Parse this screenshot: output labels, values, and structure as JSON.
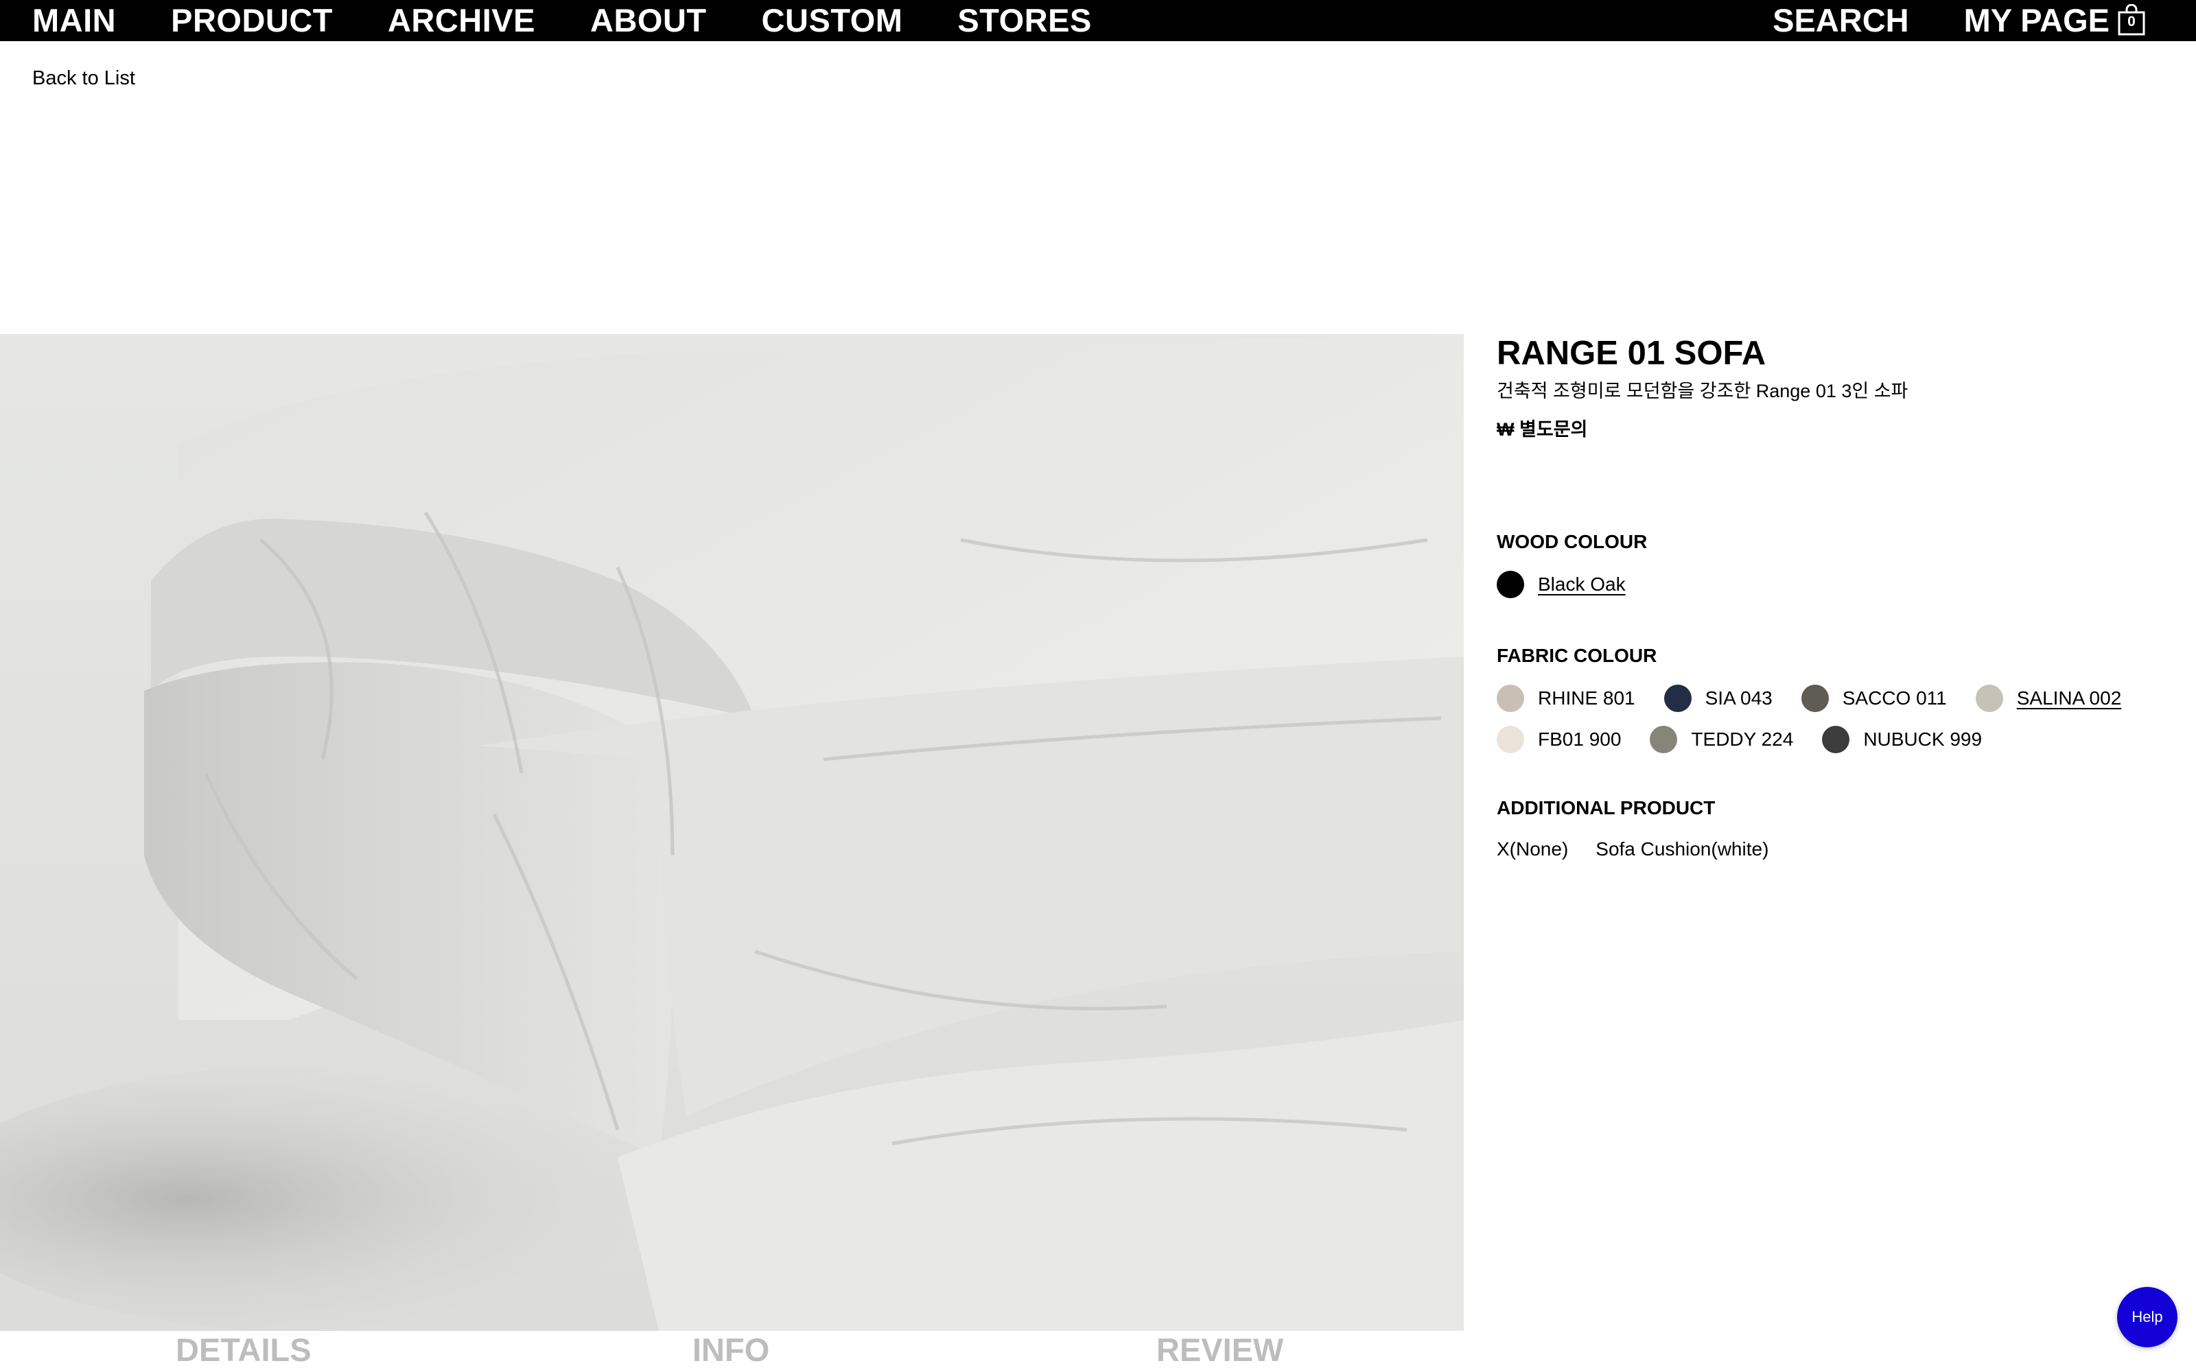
{
  "nav": {
    "left": [
      "MAIN",
      "PRODUCT",
      "ARCHIVE",
      "ABOUT",
      "CUSTOM",
      "STORES"
    ],
    "search": "SEARCH",
    "mypage": "MY PAGE",
    "cart_count": "0"
  },
  "back_label": "Back to List",
  "product": {
    "title": "RANGE 01 SOFA",
    "subtitle": "건축적 조형미로 모던함을 강조한 Range 01 3인 소파",
    "price": "₩ 별도문의"
  },
  "wood": {
    "label": "WOOD COLOUR",
    "options": [
      {
        "name": "Black Oak",
        "color": "#000000",
        "selected": true
      }
    ]
  },
  "fabric": {
    "label": "FABRIC COLOUR",
    "options": [
      {
        "name": "RHINE 801",
        "color": "#c9bfb4"
      },
      {
        "name": "SIA 043",
        "color": "#232d45"
      },
      {
        "name": "SACCO 011",
        "color": "#5f5d53"
      },
      {
        "name": "SALINA 002",
        "color": "#c7c2b8",
        "selected": true
      },
      {
        "name": "FB01 900",
        "color": "#ebe3d9"
      },
      {
        "name": "TEDDY 224",
        "color": "#86857a"
      },
      {
        "name": "NUBUCK 999",
        "color": "#3c3c3c"
      }
    ]
  },
  "additional": {
    "label": "ADDITIONAL PRODUCT",
    "options": [
      "X(None)",
      "Sofa Cushion(white)"
    ]
  },
  "tabs": [
    "DETAILS",
    "INFO",
    "REVIEW"
  ],
  "help_label": "Help"
}
